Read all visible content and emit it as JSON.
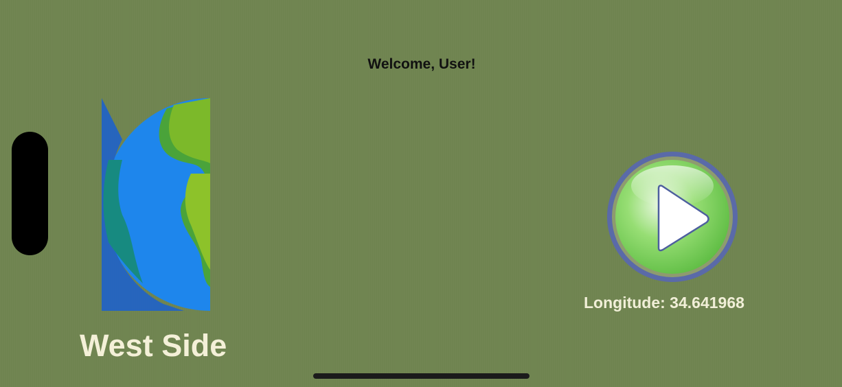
{
  "app": {
    "welcome_text": "Welcome, User!",
    "side_label": "West Side",
    "longitude_text": "Longitude: 34.641968"
  },
  "colors": {
    "background": "#6f8450",
    "ocean": "#1f8ef0",
    "land": "#86bb2b",
    "play_ring": "#5f6fb0",
    "play_fill": "#7cd45a"
  },
  "icons": {
    "globe": "half-earth-globe-icon",
    "play": "play-icon"
  }
}
